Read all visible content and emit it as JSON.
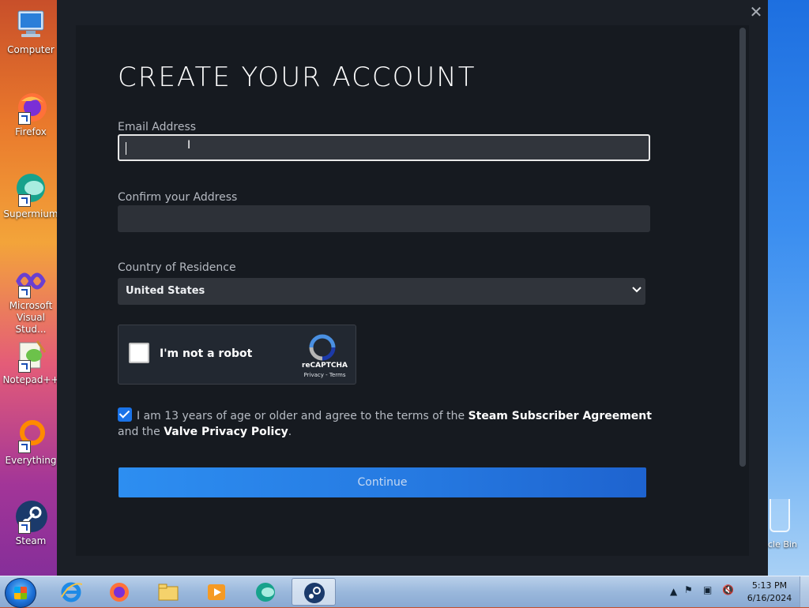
{
  "desktop": {
    "icons": [
      {
        "label": "Computer",
        "icon": "computer-icon"
      },
      {
        "label": "Firefox",
        "icon": "firefox-icon"
      },
      {
        "label": "Supermium",
        "icon": "supermium-icon"
      },
      {
        "label": "Microsoft Visual Stud...",
        "icon": "visual-studio-icon"
      },
      {
        "label": "Notepad++",
        "icon": "notepadpp-icon"
      },
      {
        "label": "Everything",
        "icon": "everything-icon"
      },
      {
        "label": "Steam",
        "icon": "steam-icon"
      }
    ],
    "recycle_bin_label": "cle Bin"
  },
  "dialog": {
    "close_glyph": "✕",
    "title": "CREATE YOUR ACCOUNT",
    "email": {
      "label": "Email Address",
      "value": ""
    },
    "confirm": {
      "label": "Confirm your Address",
      "value": ""
    },
    "country": {
      "label": "Country of Residence",
      "selected": "United States"
    },
    "captcha": {
      "text": "I'm not a robot",
      "brand": "reCAPTCHA",
      "links": "Privacy - Terms"
    },
    "agreement": {
      "checked": true,
      "prefix": "I am 13 years of age or older and agree to the terms of the",
      "link1": "Steam Subscriber Agreement",
      "middle": "and the",
      "link2": "Valve Privacy Policy",
      "suffix": "."
    },
    "continue_label": "Continue"
  },
  "taskbar": {
    "apps": [
      "internet-explorer-icon",
      "firefox-icon",
      "file-explorer-icon",
      "media-player-icon",
      "supermium-icon",
      "steam-icon"
    ],
    "active_app": "steam-icon",
    "time": "5:13 PM",
    "date": "6/16/2024"
  },
  "colors": {
    "accent": "#1a73e8",
    "button": "#2578e0",
    "panel": "#161a20"
  }
}
